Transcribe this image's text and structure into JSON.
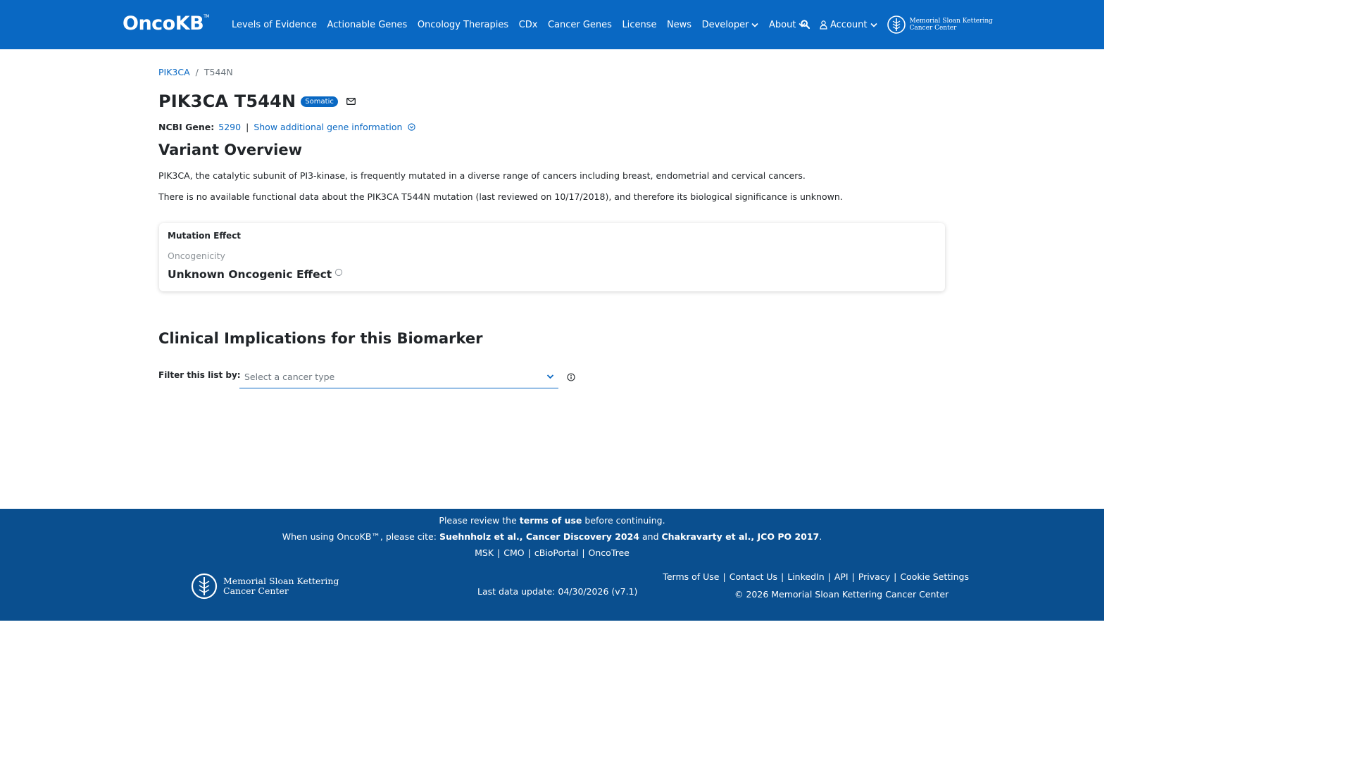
{
  "header": {
    "logo": "OncoKB",
    "logo_tm": "TM",
    "nav": [
      {
        "label": "Levels of Evidence",
        "dropdown": false
      },
      {
        "label": "Actionable Genes",
        "dropdown": false
      },
      {
        "label": "Oncology Therapies",
        "dropdown": false
      },
      {
        "label": "CDx",
        "dropdown": false
      },
      {
        "label": "Cancer Genes",
        "dropdown": false
      },
      {
        "label": "License",
        "dropdown": false
      },
      {
        "label": "News",
        "dropdown": false
      },
      {
        "label": "Developer",
        "dropdown": true
      },
      {
        "label": "About",
        "dropdown": true
      }
    ],
    "account": "Account",
    "msk_line1": "Memorial Sloan Kettering",
    "msk_line2": "Cancer Center",
    "bg_color": "#0968c3"
  },
  "breadcrumb": {
    "gene": "PIK3CA",
    "separator": "/",
    "variant": "T544N"
  },
  "title": {
    "text": "PIK3CA T544N",
    "badge": "Somatic"
  },
  "ncbi": {
    "label": "NCBI Gene:",
    "id": "5290",
    "separator": "|",
    "more": "Show additional gene information"
  },
  "overview": {
    "heading": "Variant Overview",
    "paragraph1": "PIK3CA, the catalytic subunit of PI3-kinase, is frequently mutated in a diverse range of cancers including breast, endometrial and cervical cancers.",
    "paragraph2": "There is no available functional data about the PIK3CA T544N mutation (last reviewed on 10/17/2018), and therefore its biological significance is unknown."
  },
  "mutation_card": {
    "title": "Mutation Effect",
    "subtitle": "Oncogenicity",
    "value": "Unknown Oncogenic Effect"
  },
  "clinical": {
    "heading": "Clinical Implications for this Biomarker",
    "filter_label": "Filter this list by:",
    "filter_placeholder": "Select a cancer type"
  },
  "footer": {
    "line1_pre": "Please review the",
    "line1_link": "terms of use",
    "line1_post": "before continuing.",
    "line2_pre": "When using OncoKB™, please cite:",
    "cite1": "Suehnholz et al., Cancer Discovery 2024",
    "and": "and",
    "cite2": "Chakravarty et al., JCO PO 2017",
    "period": ".",
    "links_mid": [
      "MSK",
      "CMO",
      "cBioPortal",
      "OncoTree"
    ],
    "msk_line1": "Memorial Sloan Kettering",
    "msk_line2": "Cancer Center",
    "last_update": "Last data update: 04/30/2026 (v7.1)",
    "links_right": [
      "Terms of Use",
      "Contact Us",
      "LinkedIn",
      "API",
      "Privacy",
      "Cookie Settings"
    ],
    "copyright": "© 2026 Memorial Sloan Kettering Cancer Center",
    "bg_color": "#0a4f8f"
  }
}
